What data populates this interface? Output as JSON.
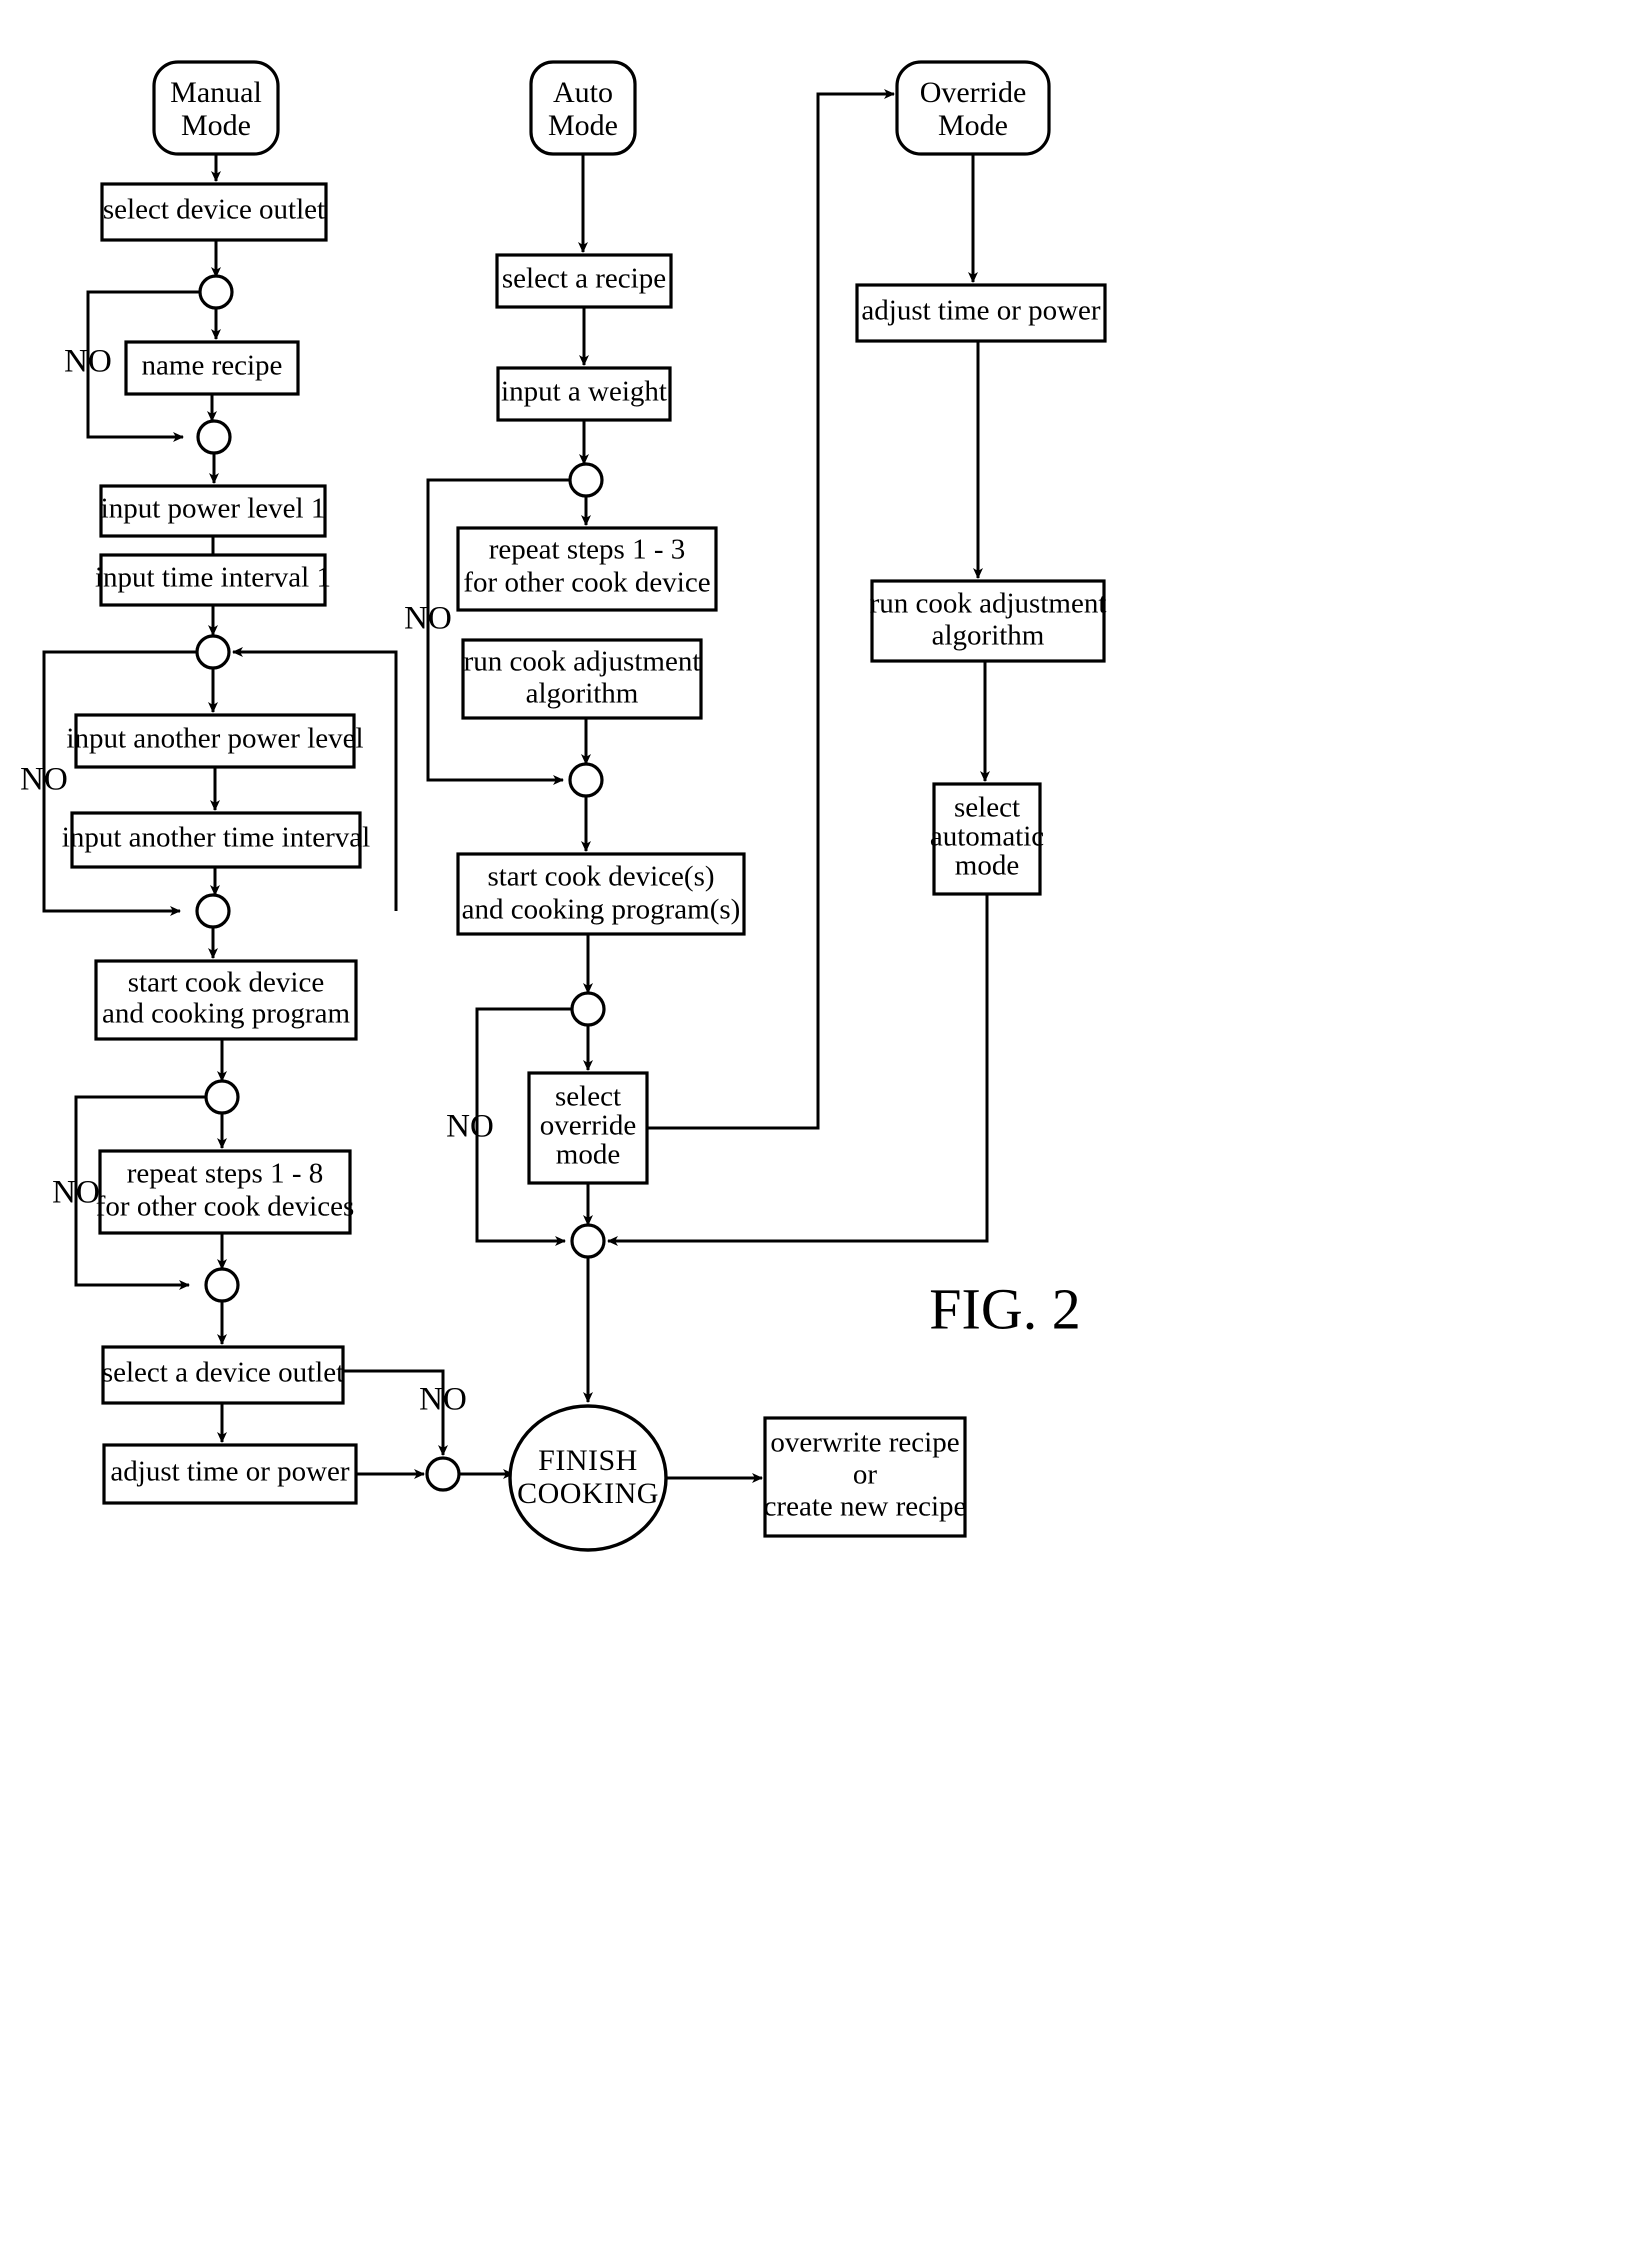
{
  "figure": {
    "caption": "FIG. 2",
    "title": "Cooking device control flowchart"
  },
  "chart_data": {
    "type": "diagram",
    "diagram_kind": "flowchart",
    "title": "FIG. 2",
    "columns": [
      "Manual Mode",
      "Auto Mode",
      "Override Mode"
    ],
    "terminators": [
      "Manual Mode",
      "Auto Mode",
      "Override Mode",
      "FINISH COOKING"
    ],
    "decision_labels": [
      "NO",
      "NO",
      "NO",
      "NO",
      "NO",
      "NO"
    ]
  },
  "manual": {
    "start": "Manual\nMode",
    "start_line1": "Manual",
    "start_line2": "Mode",
    "step1": "select device outlet",
    "step2": "name recipe",
    "step3": "input power level 1",
    "step4": "input time interval 1",
    "step5": "input another power level",
    "step6": "input another time interval",
    "step7_line1": "start cook device",
    "step7_line2": "and cooking program",
    "step8_line1": "repeat steps 1 - 8",
    "step8_line2": "for other cook devices",
    "step9": "select a device outlet",
    "step10": "adjust time or power",
    "no1": "NO",
    "no2": "NO",
    "no3": "NO",
    "no4": "NO"
  },
  "auto": {
    "start_line1": "Auto",
    "start_line2": "Mode",
    "step1": "select a recipe",
    "step2": "input a weight",
    "step3_line1": "repeat steps 1 - 3",
    "step3_line2": "for other cook device",
    "step4_line1": "run cook adjustment",
    "step4_line2": "algorithm",
    "step5_line1": "start cook device(s)",
    "step5_line2": "and cooking program(s)",
    "step6_line1": "select",
    "step6_line2": "override",
    "step6_line3": "mode",
    "no1": "NO",
    "no2": "NO"
  },
  "override": {
    "start_line1": "Override",
    "start_line2": "Mode",
    "step1": "adjust time or power",
    "step2_line1": "run cook adjustment",
    "step2_line2": "algorithm",
    "step3_line1": "select",
    "step3_line2": "automatic",
    "step3_line3": "mode"
  },
  "finish": {
    "line1": "FINISH",
    "line2": "COOKING"
  },
  "result": {
    "line1": "overwrite recipe",
    "line2": "or",
    "line3": "create new recipe"
  }
}
